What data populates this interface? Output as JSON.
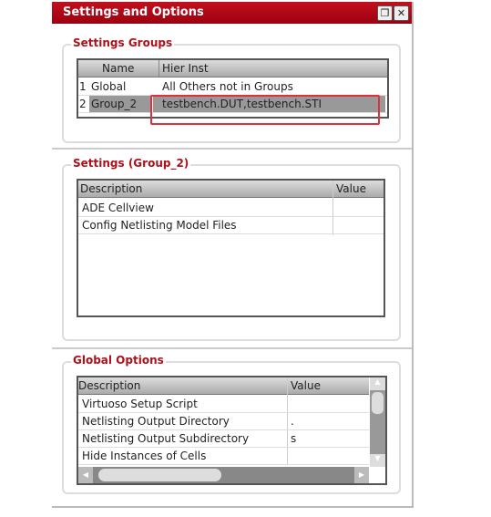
{
  "window": {
    "title": "Settings and Options",
    "restore_icon": "restore-icon",
    "close_icon": "close-icon"
  },
  "settings_groups": {
    "label": "Settings Groups",
    "columns": [
      "Name",
      "Hier Inst"
    ],
    "rows": [
      {
        "num": "1",
        "name": "Global",
        "hier": "All Others not in Groups"
      },
      {
        "num": "2",
        "name": "Group_2",
        "hier": "testbench.DUT,testbench.STI",
        "selected": true
      }
    ]
  },
  "settings": {
    "label": "Settings (Group_2)",
    "columns": [
      "Description",
      "Value"
    ],
    "rows": [
      {
        "desc": "ADE Cellview",
        "value": ""
      },
      {
        "desc": "Config Netlisting Model Files",
        "value": ""
      }
    ]
  },
  "global_options": {
    "label": "Global Options",
    "columns": [
      "Description",
      "Value"
    ],
    "rows": [
      {
        "desc": "Virtuoso Setup Script",
        "value": ""
      },
      {
        "desc": "Netlisting Output Directory",
        "value": "."
      },
      {
        "desc": "Netlisting Output Subdirectory",
        "value": "s"
      },
      {
        "desc": "Hide Instances of Cells",
        "value": ""
      }
    ]
  },
  "colors": {
    "title_bar": "#b0101a",
    "highlight": "#e03040"
  }
}
